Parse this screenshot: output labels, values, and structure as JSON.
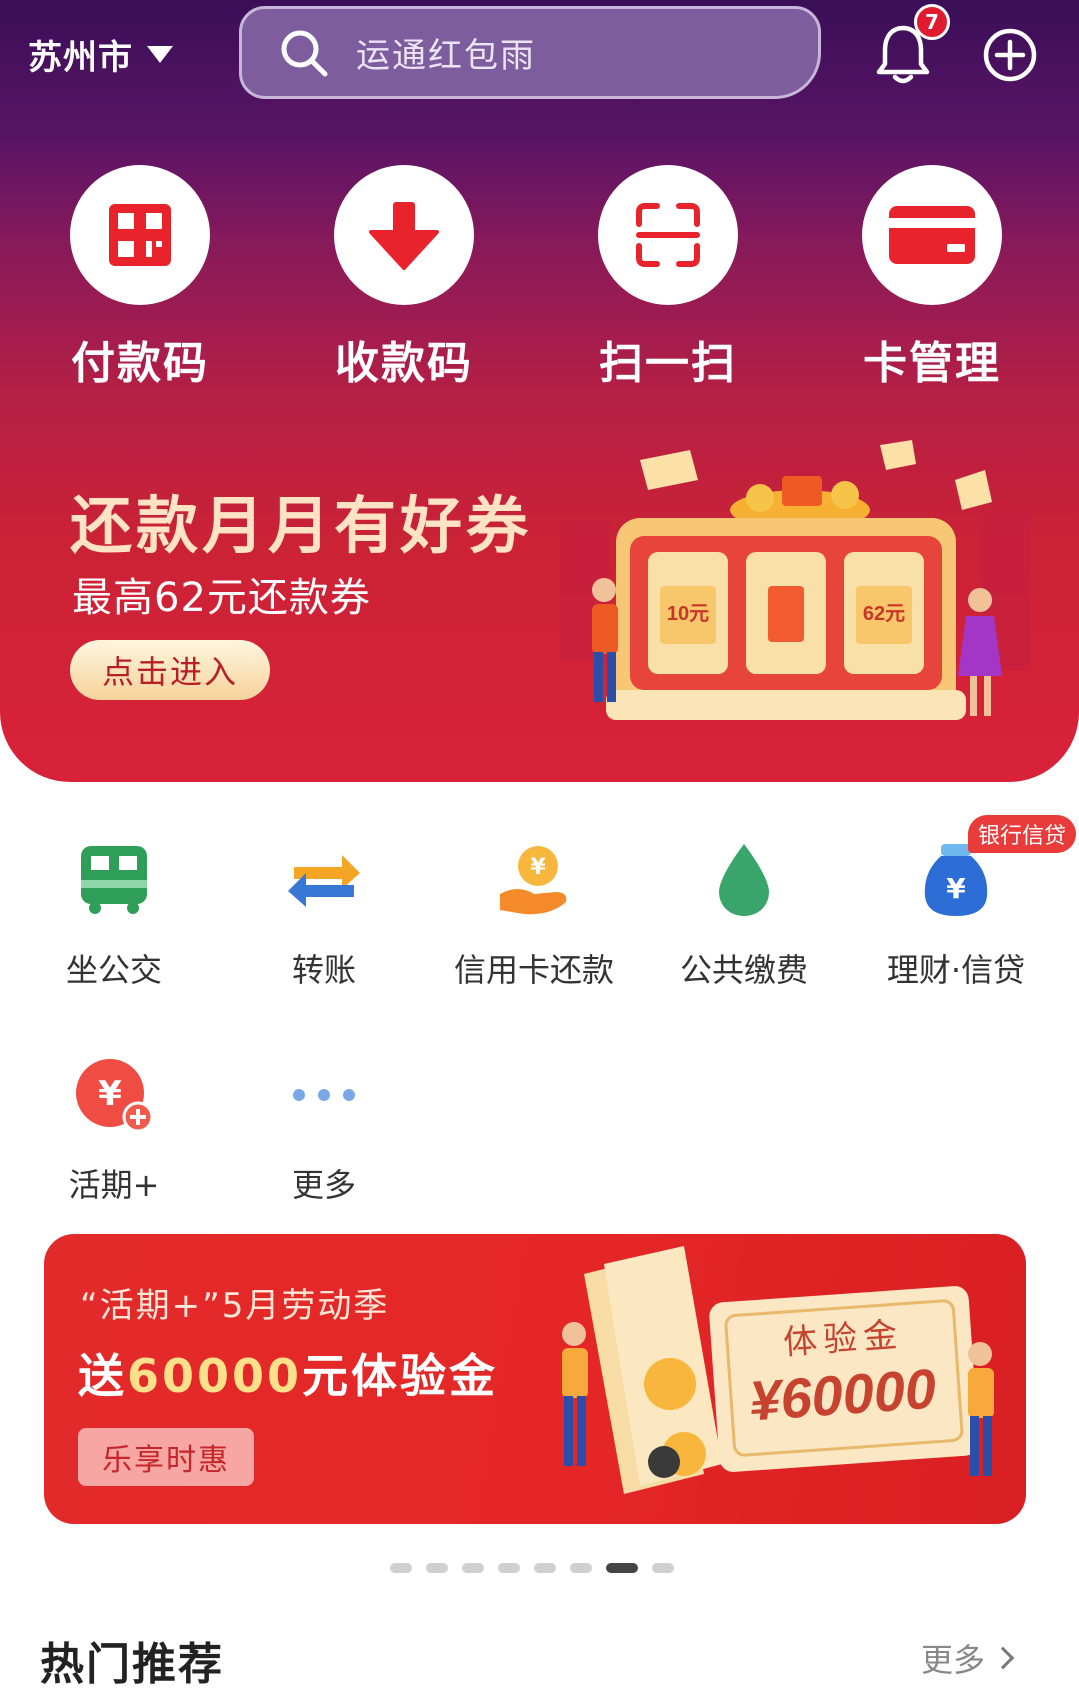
{
  "header": {
    "city": "苏州市",
    "search_placeholder": "运通红包雨",
    "notification_count": "7"
  },
  "quick_actions": [
    {
      "label": "付款码",
      "icon": "qr-code-icon"
    },
    {
      "label": "收款码",
      "icon": "arrow-down-icon"
    },
    {
      "label": "扫一扫",
      "icon": "scan-icon"
    },
    {
      "label": "卡管理",
      "icon": "card-icon"
    }
  ],
  "promo_banner": {
    "title": "还款月月有好券",
    "subtitle": "最高62元还款券",
    "button": "点击进入",
    "coupon_left": "10元",
    "coupon_right": "62元"
  },
  "services": [
    {
      "label": "坐公交",
      "icon": "bus-icon"
    },
    {
      "label": "转账",
      "icon": "transfer-icon"
    },
    {
      "label": "信用卡还款",
      "icon": "credit-repay-icon"
    },
    {
      "label": "公共缴费",
      "icon": "water-drop-icon"
    },
    {
      "label": "理财·信贷",
      "icon": "money-bag-icon"
    },
    {
      "label": "活期+",
      "icon": "yuan-plus-icon"
    },
    {
      "label": "更多",
      "icon": "more-dots-icon"
    }
  ],
  "loan_tag": "银行信贷",
  "banner2": {
    "line1": "“活期+”5月劳动季",
    "line2_prefix": "送",
    "line2_amount": "60000",
    "line2_suffix": "元体验金",
    "button": "乐享时惠",
    "card_title": "体验金",
    "card_amount": "¥60000"
  },
  "carousel": {
    "total": 8,
    "active": 7
  },
  "hot": {
    "title": "热门推荐",
    "more": "更多"
  },
  "colors": {
    "hero_top": "#3a0f58",
    "hero_bottom": "#d9223a",
    "accent_red": "#e01b2f",
    "banner_red": "#e32a2a"
  }
}
